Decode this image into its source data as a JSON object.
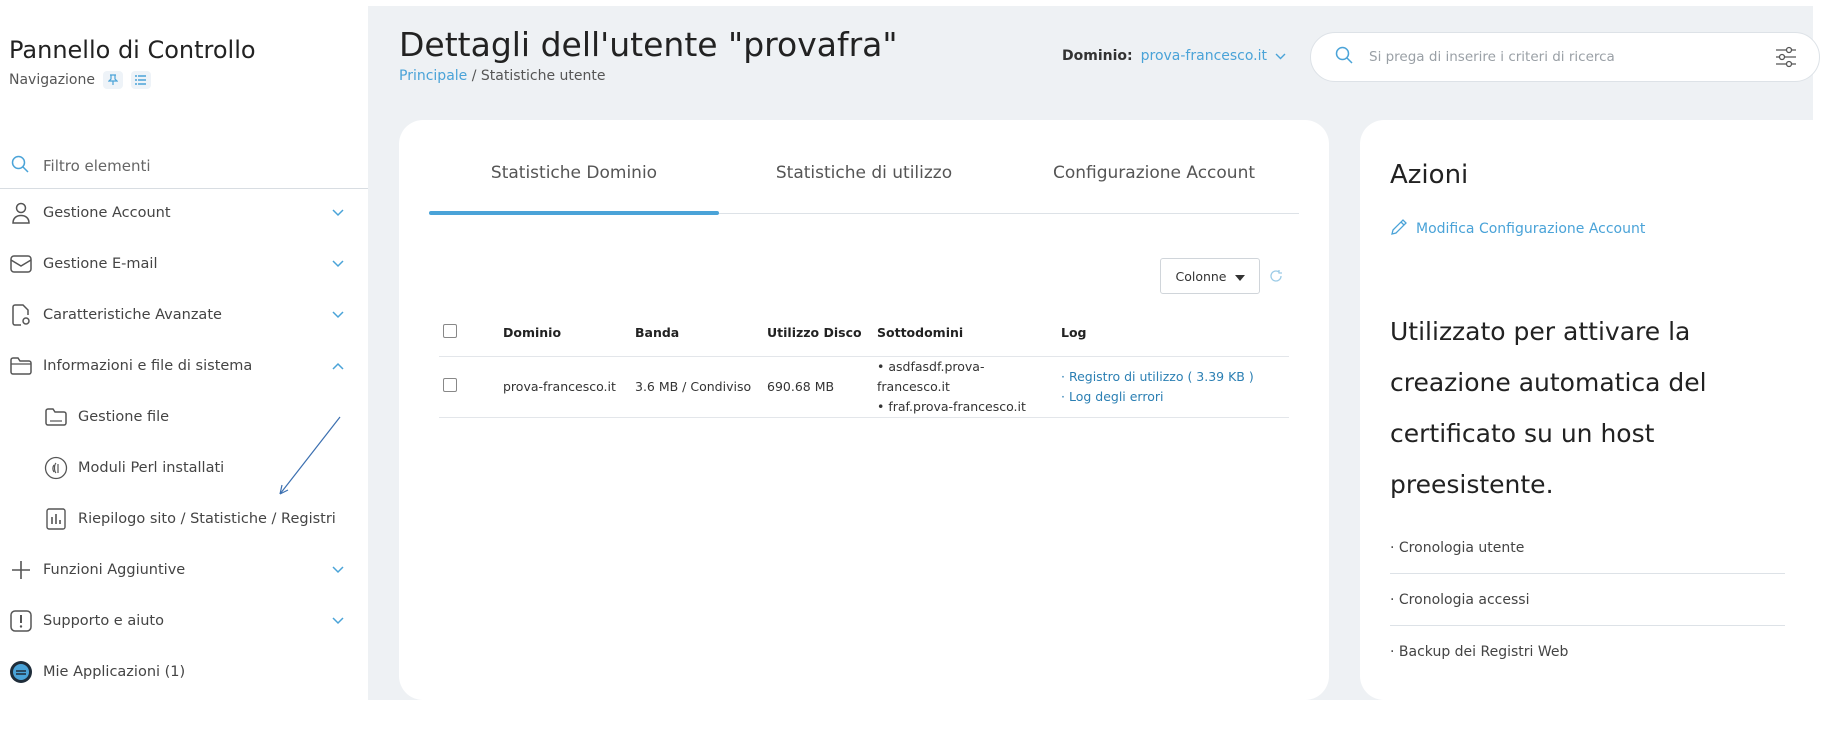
{
  "sidebar": {
    "title": "Pannello di Controllo",
    "subtitle": "Navigazione",
    "filter_placeholder": "Filtro elementi",
    "items": [
      {
        "label": "Gestione Account",
        "icon": "user-icon"
      },
      {
        "label": "Gestione E-mail",
        "icon": "mail-icon"
      },
      {
        "label": "Caratteristiche Avanzate",
        "icon": "advanced-file-icon"
      },
      {
        "label": "Informazioni e file di sistema",
        "icon": "folder-icon",
        "expanded": true
      },
      {
        "label": "Gestione file",
        "icon": "folder-icon"
      },
      {
        "label": "Moduli Perl installati",
        "icon": "perl-icon"
      },
      {
        "label": "Riepilogo sito / Statistiche / Registri",
        "icon": "stats-icon"
      },
      {
        "label": "Funzioni Aggiuntive",
        "icon": "plus-icon"
      },
      {
        "label": "Supporto e aiuto",
        "icon": "alert-icon"
      },
      {
        "label": "Mie Applicazioni (1)",
        "icon": "apps-icon"
      }
    ]
  },
  "header": {
    "title": "Dettagli dell'utente \"provafra\"",
    "breadcrumb_home": "Principale",
    "breadcrumb_sep": " / ",
    "breadcrumb_current": "Statistiche utente",
    "domain_label": "Dominio:",
    "domain_value": "prova-francesco.it",
    "search_placeholder": "Si prega di inserire i criteri di ricerca"
  },
  "main": {
    "tabs": [
      {
        "label": "Statistiche Dominio",
        "active": true
      },
      {
        "label": "Statistiche di utilizzo",
        "active": false
      },
      {
        "label": "Configurazione Account",
        "active": false
      }
    ],
    "columns_button": "Colonne",
    "table": {
      "headers": [
        "Dominio",
        "Banda",
        "Utilizzo Disco",
        "Sottodomini",
        "Log"
      ],
      "rows": [
        {
          "domain": "prova-francesco.it",
          "bandwidth": "3.6 MB / Condiviso",
          "disk": "690.68 MB",
          "subdomains": [
            "asdfasdf.prova-francesco.it",
            "fraf.prova-francesco.it"
          ],
          "logs": [
            "Registro di utilizzo ( 3.39 KB )",
            "Log degli errori"
          ]
        }
      ]
    }
  },
  "side": {
    "title": "Azioni",
    "action": "Modifica Configurazione Account",
    "description": "Utilizzato per attivare la creazione automatica del certificato su un host preesistente.",
    "links": [
      "· Cronologia utente",
      "· Cronologia accessi",
      "· Backup dei Registri Web"
    ]
  },
  "colors": {
    "accent": "#4aa3d8",
    "link": "#2b7fb3",
    "background": "#eef1f4"
  }
}
